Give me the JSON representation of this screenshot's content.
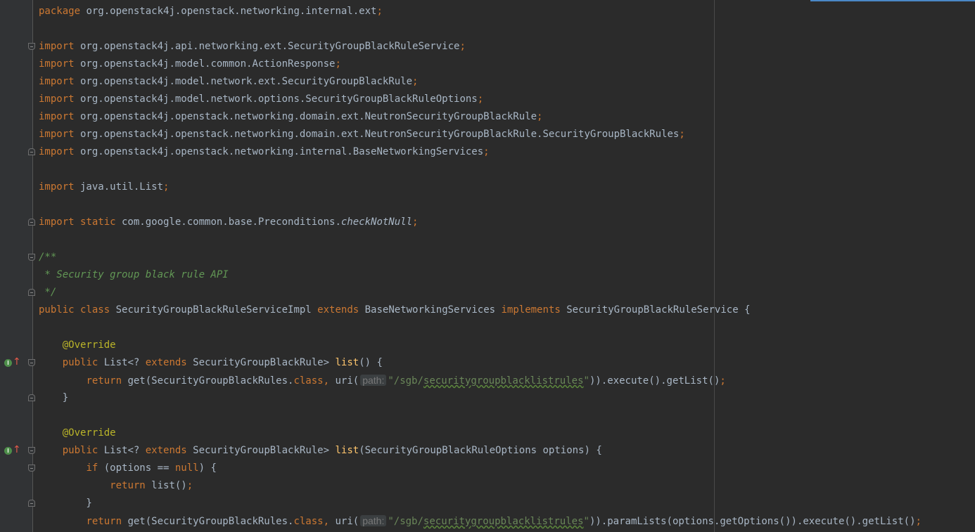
{
  "editor": {
    "lines": [
      {
        "segs": [
          [
            "k",
            "package"
          ],
          [
            "t",
            " org.openstack4j.openstack.networking.internal.ext"
          ],
          [
            "k",
            ";"
          ]
        ]
      },
      {
        "segs": []
      },
      {
        "segs": [
          [
            "k",
            "import"
          ],
          [
            "t",
            " org.openstack4j.api.networking.ext.SecurityGroupBlackRuleService"
          ],
          [
            "k",
            ";"
          ]
        ]
      },
      {
        "segs": [
          [
            "k",
            "import"
          ],
          [
            "t",
            " org.openstack4j.model.common.ActionResponse"
          ],
          [
            "k",
            ";"
          ]
        ]
      },
      {
        "segs": [
          [
            "k",
            "import"
          ],
          [
            "t",
            " org.openstack4j.model.network.ext.SecurityGroupBlackRule"
          ],
          [
            "k",
            ";"
          ]
        ]
      },
      {
        "segs": [
          [
            "k",
            "import"
          ],
          [
            "t",
            " org.openstack4j.model.network.options.SecurityGroupBlackRuleOptions"
          ],
          [
            "k",
            ";"
          ]
        ]
      },
      {
        "segs": [
          [
            "k",
            "import"
          ],
          [
            "t",
            " org.openstack4j.openstack.networking.domain.ext.NeutronSecurityGroupBlackRule"
          ],
          [
            "k",
            ";"
          ]
        ]
      },
      {
        "segs": [
          [
            "k",
            "import"
          ],
          [
            "t",
            " org.openstack4j.openstack.networking.domain.ext.NeutronSecurityGroupBlackRule.SecurityGroupBlackRules"
          ],
          [
            "k",
            ";"
          ]
        ]
      },
      {
        "segs": [
          [
            "k",
            "import"
          ],
          [
            "t",
            " org.openstack4j.openstack.networking.internal.BaseNetworkingServices"
          ],
          [
            "k",
            ";"
          ]
        ]
      },
      {
        "segs": []
      },
      {
        "segs": [
          [
            "k",
            "import"
          ],
          [
            "t",
            " java.util.List"
          ],
          [
            "k",
            ";"
          ]
        ]
      },
      {
        "segs": []
      },
      {
        "segs": [
          [
            "k",
            "import static"
          ],
          [
            "t",
            " com.google.common.base.Preconditions."
          ],
          [
            "it",
            "checkNotNull"
          ],
          [
            "k",
            ";"
          ]
        ]
      },
      {
        "segs": []
      },
      {
        "segs": [
          [
            "c",
            "/**"
          ]
        ]
      },
      {
        "segs": [
          [
            "c",
            " * Security group black rule API"
          ]
        ]
      },
      {
        "segs": [
          [
            "c",
            " */"
          ]
        ]
      },
      {
        "segs": [
          [
            "k",
            "public class"
          ],
          [
            "t",
            " SecurityGroupBlackRuleServiceImpl "
          ],
          [
            "k",
            "extends"
          ],
          [
            "t",
            " BaseNetworkingServices "
          ],
          [
            "k",
            "implements"
          ],
          [
            "t",
            " SecurityGroupBlackRuleService {"
          ]
        ]
      },
      {
        "segs": []
      },
      {
        "segs": [
          [
            "t",
            "    "
          ],
          [
            "a",
            "@Override"
          ]
        ]
      },
      {
        "segs": [
          [
            "t",
            "    "
          ],
          [
            "k",
            "public"
          ],
          [
            "t",
            " List<? "
          ],
          [
            "k",
            "extends"
          ],
          [
            "t",
            " SecurityGroupBlackRule> "
          ],
          [
            "m",
            "list"
          ],
          [
            "t",
            "() {"
          ]
        ]
      },
      {
        "segs": [
          [
            "t",
            "        "
          ],
          [
            "k",
            "return"
          ],
          [
            "t",
            " get(SecurityGroupBlackRules."
          ],
          [
            "k",
            "class"
          ],
          [
            "k",
            ","
          ],
          [
            "t",
            " uri("
          ],
          [
            "hint",
            "path:"
          ],
          [
            "s",
            "\"/sgb/"
          ],
          [
            "sq",
            "securitygroupblacklistrules"
          ],
          [
            "s",
            "\""
          ],
          [
            "t",
            ")).execute().getList()"
          ],
          [
            "k",
            ";"
          ]
        ]
      },
      {
        "segs": [
          [
            "t",
            "    }"
          ]
        ]
      },
      {
        "segs": []
      },
      {
        "segs": [
          [
            "t",
            "    "
          ],
          [
            "a",
            "@Override"
          ]
        ]
      },
      {
        "segs": [
          [
            "t",
            "    "
          ],
          [
            "k",
            "public"
          ],
          [
            "t",
            " List<? "
          ],
          [
            "k",
            "extends"
          ],
          [
            "t",
            " SecurityGroupBlackRule> "
          ],
          [
            "m",
            "list"
          ],
          [
            "t",
            "(SecurityGroupBlackRuleOptions options) {"
          ]
        ]
      },
      {
        "segs": [
          [
            "t",
            "        "
          ],
          [
            "k",
            "if"
          ],
          [
            "t",
            " (options == "
          ],
          [
            "k",
            "null"
          ],
          [
            "t",
            ") {"
          ]
        ]
      },
      {
        "segs": [
          [
            "t",
            "            "
          ],
          [
            "k",
            "return"
          ],
          [
            "t",
            " list()"
          ],
          [
            "k",
            ";"
          ]
        ]
      },
      {
        "segs": [
          [
            "t",
            "        }"
          ]
        ]
      },
      {
        "segs": [
          [
            "t",
            "        "
          ],
          [
            "k",
            "return"
          ],
          [
            "t",
            " get(SecurityGroupBlackRules."
          ],
          [
            "k",
            "class"
          ],
          [
            "k",
            ","
          ],
          [
            "t",
            " uri("
          ],
          [
            "hint",
            "path:"
          ],
          [
            "s",
            "\"/sgb/"
          ],
          [
            "sq",
            "securitygroupblacklistrules"
          ],
          [
            "s",
            "\""
          ],
          [
            "t",
            ")).paramLists(options.getOptions()).execute().getList()"
          ],
          [
            "k",
            ";"
          ]
        ]
      }
    ],
    "fold_markers": [
      {
        "line": 2,
        "kind": "start"
      },
      {
        "line": 8,
        "kind": "end"
      },
      {
        "line": 12,
        "kind": "end"
      },
      {
        "line": 14,
        "kind": "start"
      },
      {
        "line": 16,
        "kind": "end"
      },
      {
        "line": 20,
        "kind": "start"
      },
      {
        "line": 22,
        "kind": "end"
      },
      {
        "line": 25,
        "kind": "start"
      },
      {
        "line": 26,
        "kind": "start"
      },
      {
        "line": 28,
        "kind": "end"
      }
    ],
    "override_markers": [
      20,
      25
    ]
  },
  "colors": {
    "background": "#2b2b2b",
    "text": "#a9b7c6",
    "keyword": "#cc7832",
    "annotation": "#bbb529",
    "comment": "#629755",
    "string": "#6a8759",
    "method": "#ffc66d"
  }
}
